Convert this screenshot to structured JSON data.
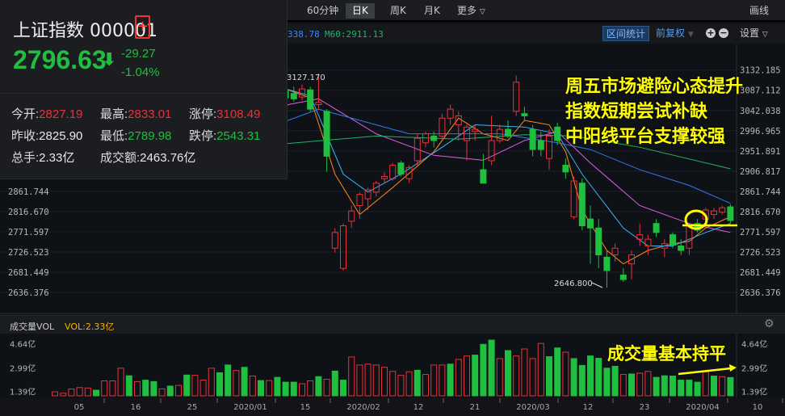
{
  "toolbar": {
    "tabs": [
      {
        "label": "60分钟"
      },
      {
        "label": "日K"
      },
      {
        "label": "周K"
      },
      {
        "label": "月K"
      },
      {
        "label": "更多"
      }
    ],
    "draw": "画线"
  },
  "indicators": {
    "ma30": "338.78",
    "ma60": "M60:2911.13",
    "range_stats": "区间统计",
    "adjust": "前复权",
    "settings": "设置"
  },
  "quote": {
    "name": "上证指数",
    "code": "000001",
    "price": "2796.63",
    "change": "-29.27",
    "change_pct": "-1.04%",
    "stats": [
      {
        "label": "今开:",
        "value": "2827.19",
        "color": "red"
      },
      {
        "label": "最高:",
        "value": "2833.01",
        "color": "red"
      },
      {
        "label": "涨停:",
        "value": "3108.49",
        "color": "red"
      },
      {
        "label": "昨收:",
        "value": "2825.90",
        "color": "wht"
      },
      {
        "label": "最低:",
        "value": "2789.98",
        "color": "grn"
      },
      {
        "label": "跌停:",
        "value": "2543.31",
        "color": "grn"
      },
      {
        "label": "总手:",
        "value": "2.33亿",
        "color": "wht"
      },
      {
        "label": "成交额:",
        "value": "2463.76亿",
        "color": "wht"
      }
    ]
  },
  "annotations": {
    "lines": [
      "周五市场避险心态提升",
      "指数短期尝试补缺",
      "中阳线平台支撑较强"
    ],
    "volume_note": "成交量基本持平",
    "high_label": "3127.170",
    "low_label": "2646.800"
  },
  "volume_header": {
    "title": "成交量VOL",
    "value": "VOL:2.33亿"
  },
  "colors": {
    "up": "#e8323a",
    "down": "#1fbf3f",
    "annotation": "#ffff00"
  },
  "chart_data": [
    {
      "type": "candlestick",
      "title": "上证指数 日K",
      "y_ticks": [
        "3132.185",
        "3087.112",
        "3042.038",
        "2996.965",
        "2951.891",
        "2906.817",
        "2861.744",
        "2816.670",
        "2771.597",
        "2726.523",
        "2681.449",
        "2636.376"
      ],
      "left_y_ticks": [
        "2861.744",
        "2816.670",
        "2771.597",
        "2726.523",
        "2681.449",
        "2636.376"
      ],
      "ylim": [
        2636.376,
        3132.185
      ],
      "first_visible_index": 28,
      "ohlc": [
        [
          3085,
          3110,
          3060,
          3070
        ],
        [
          3080,
          3095,
          3062,
          3068
        ],
        [
          3072,
          3100,
          3065,
          3090
        ],
        [
          3088,
          3095,
          3040,
          3045
        ],
        [
          3055,
          3125,
          3045,
          3060
        ],
        [
          3040,
          3045,
          2905,
          2940
        ],
        [
          2735,
          2780,
          2725,
          2770
        ],
        [
          2690,
          2790,
          2685,
          2785
        ],
        [
          2795,
          2830,
          2780,
          2818
        ],
        [
          2830,
          2860,
          2800,
          2855
        ],
        [
          2845,
          2870,
          2820,
          2865
        ],
        [
          2860,
          2885,
          2850,
          2880
        ],
        [
          2890,
          2905,
          2880,
          2895
        ],
        [
          2890,
          2925,
          2885,
          2920
        ],
        [
          2925,
          2930,
          2895,
          2900
        ],
        [
          2890,
          2920,
          2880,
          2915
        ],
        [
          2930,
          2990,
          2920,
          2980
        ],
        [
          2970,
          2995,
          2960,
          2990
        ],
        [
          2985,
          2995,
          2960,
          2975
        ],
        [
          2985,
          3035,
          2980,
          3025
        ],
        [
          3025,
          3055,
          3010,
          3045
        ],
        [
          3010,
          3040,
          2975,
          3030
        ],
        [
          2975,
          3010,
          2930,
          3005
        ],
        [
          2995,
          3010,
          2975,
          3000
        ],
        [
          2910,
          2945,
          2880,
          2880
        ],
        [
          2930,
          3030,
          2920,
          2975
        ],
        [
          2975,
          3010,
          2970,
          3000
        ],
        [
          3000,
          3020,
          2980,
          2985
        ],
        [
          3040,
          3120,
          3030,
          3105
        ],
        [
          3035,
          3050,
          3020,
          3030
        ],
        [
          3000,
          3010,
          2940,
          2955
        ],
        [
          2975,
          2995,
          2940,
          2955
        ],
        [
          2935,
          3000,
          2910,
          2985
        ],
        [
          3005,
          3015,
          2965,
          2975
        ],
        [
          2920,
          2935,
          2890,
          2905
        ],
        [
          2805,
          2895,
          2800,
          2885
        ],
        [
          2880,
          2890,
          2775,
          2785
        ],
        [
          2800,
          2830,
          2700,
          2780
        ],
        [
          2780,
          2800,
          2690,
          2720
        ],
        [
          2715,
          2730,
          2646.8,
          2685
        ],
        [
          2720,
          2745,
          2705,
          2735
        ],
        [
          2675,
          2690,
          2660,
          2665
        ],
        [
          2700,
          2730,
          2665,
          2720
        ],
        [
          2755,
          2790,
          2740,
          2765
        ],
        [
          2740,
          2765,
          2720,
          2755
        ],
        [
          2790,
          2800,
          2760,
          2770
        ],
        [
          2735,
          2755,
          2715,
          2745
        ],
        [
          2765,
          2770,
          2735,
          2742
        ],
        [
          2740,
          2755,
          2720,
          2730
        ],
        [
          2735,
          2790,
          2720,
          2785
        ],
        [
          2790,
          2800,
          2770,
          2775
        ],
        [
          2800,
          2825,
          2795,
          2820
        ],
        [
          2810,
          2825,
          2800,
          2818
        ],
        [
          2815,
          2830,
          2810,
          2825
        ],
        [
          2827.19,
          2833.01,
          2789.98,
          2796.63
        ]
      ],
      "ma_series": [
        {
          "name": "MA5",
          "color": "#ff8c1a",
          "points": [
            [
              28,
              3090
            ],
            [
              31,
              3070
            ],
            [
              34,
              2900
            ],
            [
              37,
              2810
            ],
            [
              41,
              2870
            ],
            [
              46,
              2950
            ],
            [
              49,
              3025
            ],
            [
              52,
              2990
            ],
            [
              55,
              2975
            ],
            [
              57,
              3020
            ],
            [
              60,
              3010
            ],
            [
              62,
              2950
            ],
            [
              64,
              2820
            ],
            [
              67,
              2730
            ],
            [
              69,
              2700
            ],
            [
              72,
              2730
            ],
            [
              75,
              2745
            ],
            [
              77,
              2750
            ],
            [
              79,
              2780
            ],
            [
              82,
              2805
            ]
          ]
        },
        {
          "name": "MA10",
          "color": "#3ab4f2",
          "points": [
            [
              28,
              3090
            ],
            [
              31,
              3075
            ],
            [
              35,
              2900
            ],
            [
              38,
              2860
            ],
            [
              42,
              2900
            ],
            [
              47,
              2960
            ],
            [
              51,
              3010
            ],
            [
              57,
              3005
            ],
            [
              61,
              2990
            ],
            [
              64,
              2900
            ],
            [
              69,
              2780
            ],
            [
              72,
              2740
            ],
            [
              75,
              2740
            ],
            [
              79,
              2770
            ],
            [
              82,
              2790
            ]
          ]
        },
        {
          "name": "MA20",
          "color": "#e060e0",
          "points": [
            [
              28,
              3054
            ],
            [
              32,
              3068
            ],
            [
              39,
              2990
            ],
            [
              46,
              2942
            ],
            [
              52,
              2931
            ],
            [
              57,
              2975
            ],
            [
              61,
              2995
            ],
            [
              65,
              2925
            ],
            [
              71,
              2830
            ],
            [
              77,
              2790
            ],
            [
              82,
              2770
            ]
          ]
        },
        {
          "name": "MA30",
          "color": "#2f7cf0",
          "points": [
            [
              28,
              3018
            ],
            [
              32,
              3045
            ],
            [
              43,
              2990
            ],
            [
              54,
              2990
            ],
            [
              61,
              2970
            ],
            [
              65,
              2955
            ],
            [
              71,
              2910
            ],
            [
              77,
              2875
            ],
            [
              82,
              2835
            ]
          ]
        },
        {
          "name": "MA60",
          "color": "#20b46a",
          "points": [
            [
              28,
              2968
            ],
            [
              39,
              2985
            ],
            [
              49,
              2978
            ],
            [
              57,
              2988
            ],
            [
              63,
              2985
            ],
            [
              71,
              2960
            ],
            [
              82,
              2912
            ]
          ]
        }
      ]
    },
    {
      "type": "bar",
      "title": "成交量VOL",
      "unit": "亿",
      "y_ticks": [
        "4.64亿",
        "2.99亿",
        "1.39亿"
      ],
      "ylim": [
        1.07,
        4.9
      ],
      "x_ticks": [
        "05",
        "16",
        "25",
        "2020/01",
        "15",
        "2020/02",
        "12",
        "21",
        "2020/03",
        "12",
        "23",
        "2020/04",
        "10"
      ],
      "values": [
        1.35,
        1.25,
        1.54,
        1.64,
        1.61,
        1.46,
        2.1,
        2.1,
        2.97,
        2.45,
        2.05,
        2.15,
        2.05,
        1.55,
        1.74,
        1.79,
        2.5,
        2.48,
        2.15,
        2.97,
        2.66,
        3.19,
        2.81,
        3.03,
        2.43,
        2.12,
        2.12,
        2.34,
        2.01,
        2.01,
        1.9,
        2.1,
        2.39,
        2.21,
        2.77,
        2.15,
        3.74,
        3.19,
        3.25,
        3.19,
        3.03,
        2.75,
        2.48,
        2.72,
        2.83,
        2.54,
        3.19,
        3.19,
        3.25,
        3.57,
        3.81,
        3.87,
        4.61,
        4.9,
        3.63,
        4.18,
        3.81,
        4.29,
        3.63,
        4.67,
        3.76,
        4.36,
        4.07,
        3.63,
        3.16,
        3.81,
        3.65,
        2.97,
        3.1,
        2.54,
        2.57,
        2.63,
        2.75,
        2.34,
        2.45,
        2.43,
        2.15,
        2.15,
        2.01,
        2.72,
        2.43,
        2.39,
        2.33
      ],
      "up": [
        1,
        1,
        1,
        1,
        1,
        0,
        1,
        1,
        1,
        0,
        1,
        0,
        0,
        1,
        0,
        1,
        0,
        1,
        1,
        1,
        0,
        0,
        1,
        0,
        1,
        0,
        1,
        0,
        0,
        0,
        1,
        1,
        0,
        1,
        0,
        0,
        1,
        1,
        1,
        1,
        1,
        1,
        1,
        1,
        0,
        1,
        1,
        1,
        0,
        1,
        1,
        0,
        0,
        0,
        1,
        0,
        1,
        1,
        1,
        1,
        0,
        0,
        1,
        0,
        0,
        0,
        0,
        0,
        0,
        1,
        0,
        1,
        1,
        0,
        0,
        0,
        0,
        0,
        0,
        1,
        0,
        1,
        0
      ]
    }
  ]
}
